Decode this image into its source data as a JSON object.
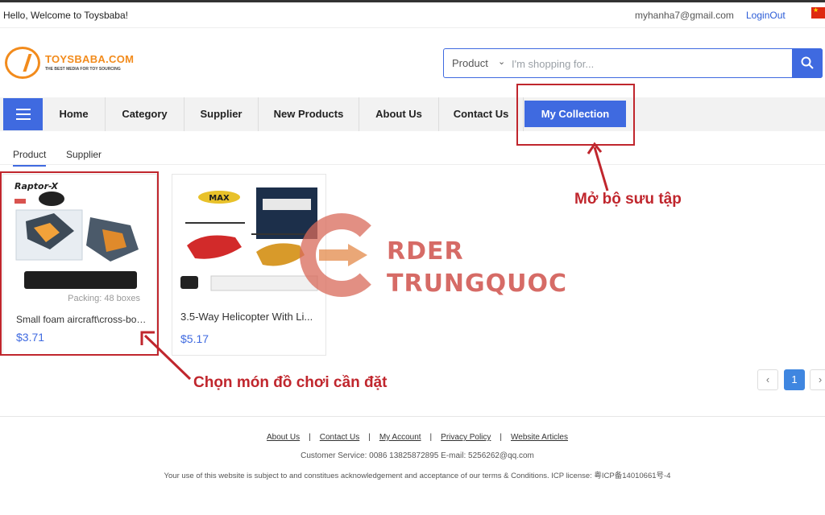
{
  "topbar": {
    "welcome": "Hello, Welcome to Toysbaba!",
    "email": "myhanha7@gmail.com",
    "logout": "LoginOut",
    "flag_icon": "china-flag-icon"
  },
  "logo": {
    "name": "TOYSBABA.COM",
    "tagline": "THE BEST MEDIA FOR TOY SOURCING"
  },
  "search": {
    "scope": "Product",
    "placeholder": "I'm shopping for...",
    "button_icon": "search-icon"
  },
  "nav": {
    "menu_icon": "hamburger-menu-icon",
    "items": [
      {
        "label": "Home"
      },
      {
        "label": "Category"
      },
      {
        "label": "Supplier"
      },
      {
        "label": "New Products"
      },
      {
        "label": "About Us"
      },
      {
        "label": "Contact Us"
      },
      {
        "label": "My Collection",
        "active": true
      }
    ]
  },
  "tabs": [
    {
      "label": "Product",
      "active": true
    },
    {
      "label": "Supplier"
    }
  ],
  "products": [
    {
      "image_title": "Raptor-X",
      "packing": "Packing: 48 boxes",
      "name": "Small foam aircraft\\cross-bord...",
      "price": "$3.71"
    },
    {
      "image_title": "MAX",
      "name": "3.5-Way Helicopter With Li...",
      "price": "$5.17"
    }
  ],
  "pagination": {
    "prev": "‹",
    "current": "1",
    "next": "›"
  },
  "annotations": {
    "collection_hint": "Mở bộ sưu tập",
    "choose_hint": "Chọn món đồ chơi cần đặt"
  },
  "watermark": {
    "line1": "RDER",
    "line2": "TRUNGQUOC"
  },
  "footer": {
    "links": [
      "About Us",
      "Contact Us",
      "My Account",
      "Privacy Policy",
      "Website Articles"
    ],
    "separator": "|",
    "service": "Customer Service: 0086 13825872895   E-mail: 5256262@qq.com",
    "legal": "Your use of this website is subject to and constitues acknowledgement and acceptance of our terms & Conditions. ICP license: 粤ICP备14010661号-4"
  },
  "colors": {
    "accent": "#3f6ae0",
    "brand_orange": "#f28b1c",
    "annotation_red": "#c0262d"
  }
}
